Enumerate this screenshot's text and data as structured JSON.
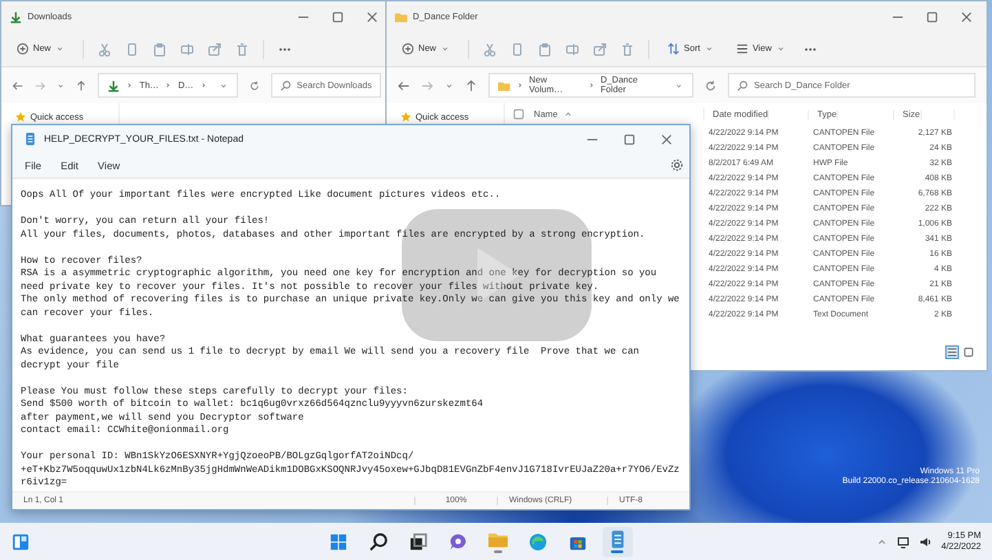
{
  "downloads_window": {
    "title": "Downloads",
    "new_button": "New",
    "path": [
      "Th…",
      "D…"
    ],
    "search": {
      "placeholder": "Search Downloads"
    },
    "sidebar": [
      "Quick access"
    ]
  },
  "folder_window": {
    "title": "D_Dance Folder",
    "new_button": "New",
    "sort_button": "Sort",
    "view_button": "View",
    "path": [
      "New Volum…",
      "D_Dance Folder"
    ],
    "search": {
      "placeholder": "Search D_Dance Folder"
    },
    "sidebar": [
      "Quick access"
    ],
    "columns": [
      "Name",
      "Date modified",
      "Type",
      "Size"
    ],
    "rows": [
      {
        "date": "4/22/2022 9:14 PM",
        "type": "CANTOPEN File",
        "size": "2,127 KB"
      },
      {
        "date": "4/22/2022 9:14 PM",
        "type": "CANTOPEN File",
        "size": "24 KB"
      },
      {
        "date": "8/2/2017 6:49 AM",
        "type": "HWP File",
        "size": "32 KB"
      },
      {
        "date": "4/22/2022 9:14 PM",
        "type": "CANTOPEN File",
        "size": "408 KB"
      },
      {
        "date": "4/22/2022 9:14 PM",
        "type": "CANTOPEN File",
        "size": "6,768 KB"
      },
      {
        "date": "4/22/2022 9:14 PM",
        "type": "CANTOPEN File",
        "size": "222 KB"
      },
      {
        "date": "4/22/2022 9:14 PM",
        "type": "CANTOPEN File",
        "size": "1,006 KB"
      },
      {
        "date": "4/22/2022 9:14 PM",
        "type": "CANTOPEN File",
        "size": "341 KB"
      },
      {
        "date": "4/22/2022 9:14 PM",
        "type": "CANTOPEN File",
        "size": "16 KB"
      },
      {
        "date": "4/22/2022 9:14 PM",
        "type": "CANTOPEN File",
        "size": "4 KB"
      },
      {
        "date": "4/22/2022 9:14 PM",
        "type": "CANTOPEN File",
        "size": "21 KB"
      },
      {
        "date": "4/22/2022 9:14 PM",
        "type": "CANTOPEN File",
        "size": "8,461 KB"
      },
      {
        "date": "4/22/2022 9:14 PM",
        "type": "Text Document",
        "size": "2 KB"
      }
    ],
    "view_toggle": [
      {
        "kind": "details",
        "selected": true
      },
      {
        "kind": "tiles",
        "selected": false
      }
    ]
  },
  "notepad": {
    "title": "HELP_DECRYPT_YOUR_FILES.txt - Notepad",
    "menu": [
      "File",
      "Edit",
      "View"
    ],
    "paragraphs": [
      [
        "Oops All Of your important files were encrypted Like document pictures videos etc.."
      ],
      [
        "Don't worry, you can return all your files!",
        "All your files, documents, photos, databases and other important files are encrypted by a strong encryption."
      ],
      [
        "How to recover files?",
        "RSA is a asymmetric cryptographic algorithm, you need one key for encryption and one key for decryption so you",
        "need private key to recover your files. It's not possible to recover your files without private key.",
        "The only method of recovering files is to purchase an unique private key.Only we can give you this key and only we",
        "can recover your files."
      ],
      [
        "What guarantees you have?",
        "As evidence, you can send us 1 file to decrypt by email We will send you a recovery file  Prove that we can",
        "decrypt your file"
      ],
      [
        "Please You must follow these steps carefully to decrypt your files:",
        "Send $500 worth of bitcoin to wallet: bc1q6ug0vrxz66d564qznclu9yyyvn6zurskezmt64",
        "after payment,we will send you Decryptor software",
        "contact email: CCWhite@onionmail.org"
      ],
      [
        "Your personal ID: WBn1SkYzO6ESXNYR+YgjQzoeoPB/BOLgzGqlgorfAT2oiNDcq/",
        "+eT+Kbz7W5oqquwUx1zbN4Lk6zMnBy35jgHdmWnWeADikm1DOBGxKSOQNRJvy45oxew+GJbqD81EVGnZbF4envJ1G718IvrEUJaZ20a+r7YO6/EvZz",
        "r6iv1zg="
      ]
    ],
    "status": [
      "Ln 1, Col 1",
      "100%",
      "Windows (CRLF)",
      "UTF-8"
    ]
  },
  "desktop": {
    "os_watermark": [
      "Windows 11 Pro",
      "Build 22000.co_release.210604-1628"
    ]
  },
  "taskbar": {
    "apps": [
      {
        "kind": "start",
        "running": false
      },
      {
        "kind": "search",
        "running": false
      },
      {
        "kind": "taskview",
        "running": false
      },
      {
        "kind": "chat",
        "running": false
      },
      {
        "kind": "explorer",
        "running": true
      },
      {
        "kind": "edge",
        "running": false
      },
      {
        "kind": "store",
        "running": false
      },
      {
        "kind": "notepad",
        "running": true
      }
    ],
    "time": "9:15 PM",
    "date": "4/22/2022"
  }
}
